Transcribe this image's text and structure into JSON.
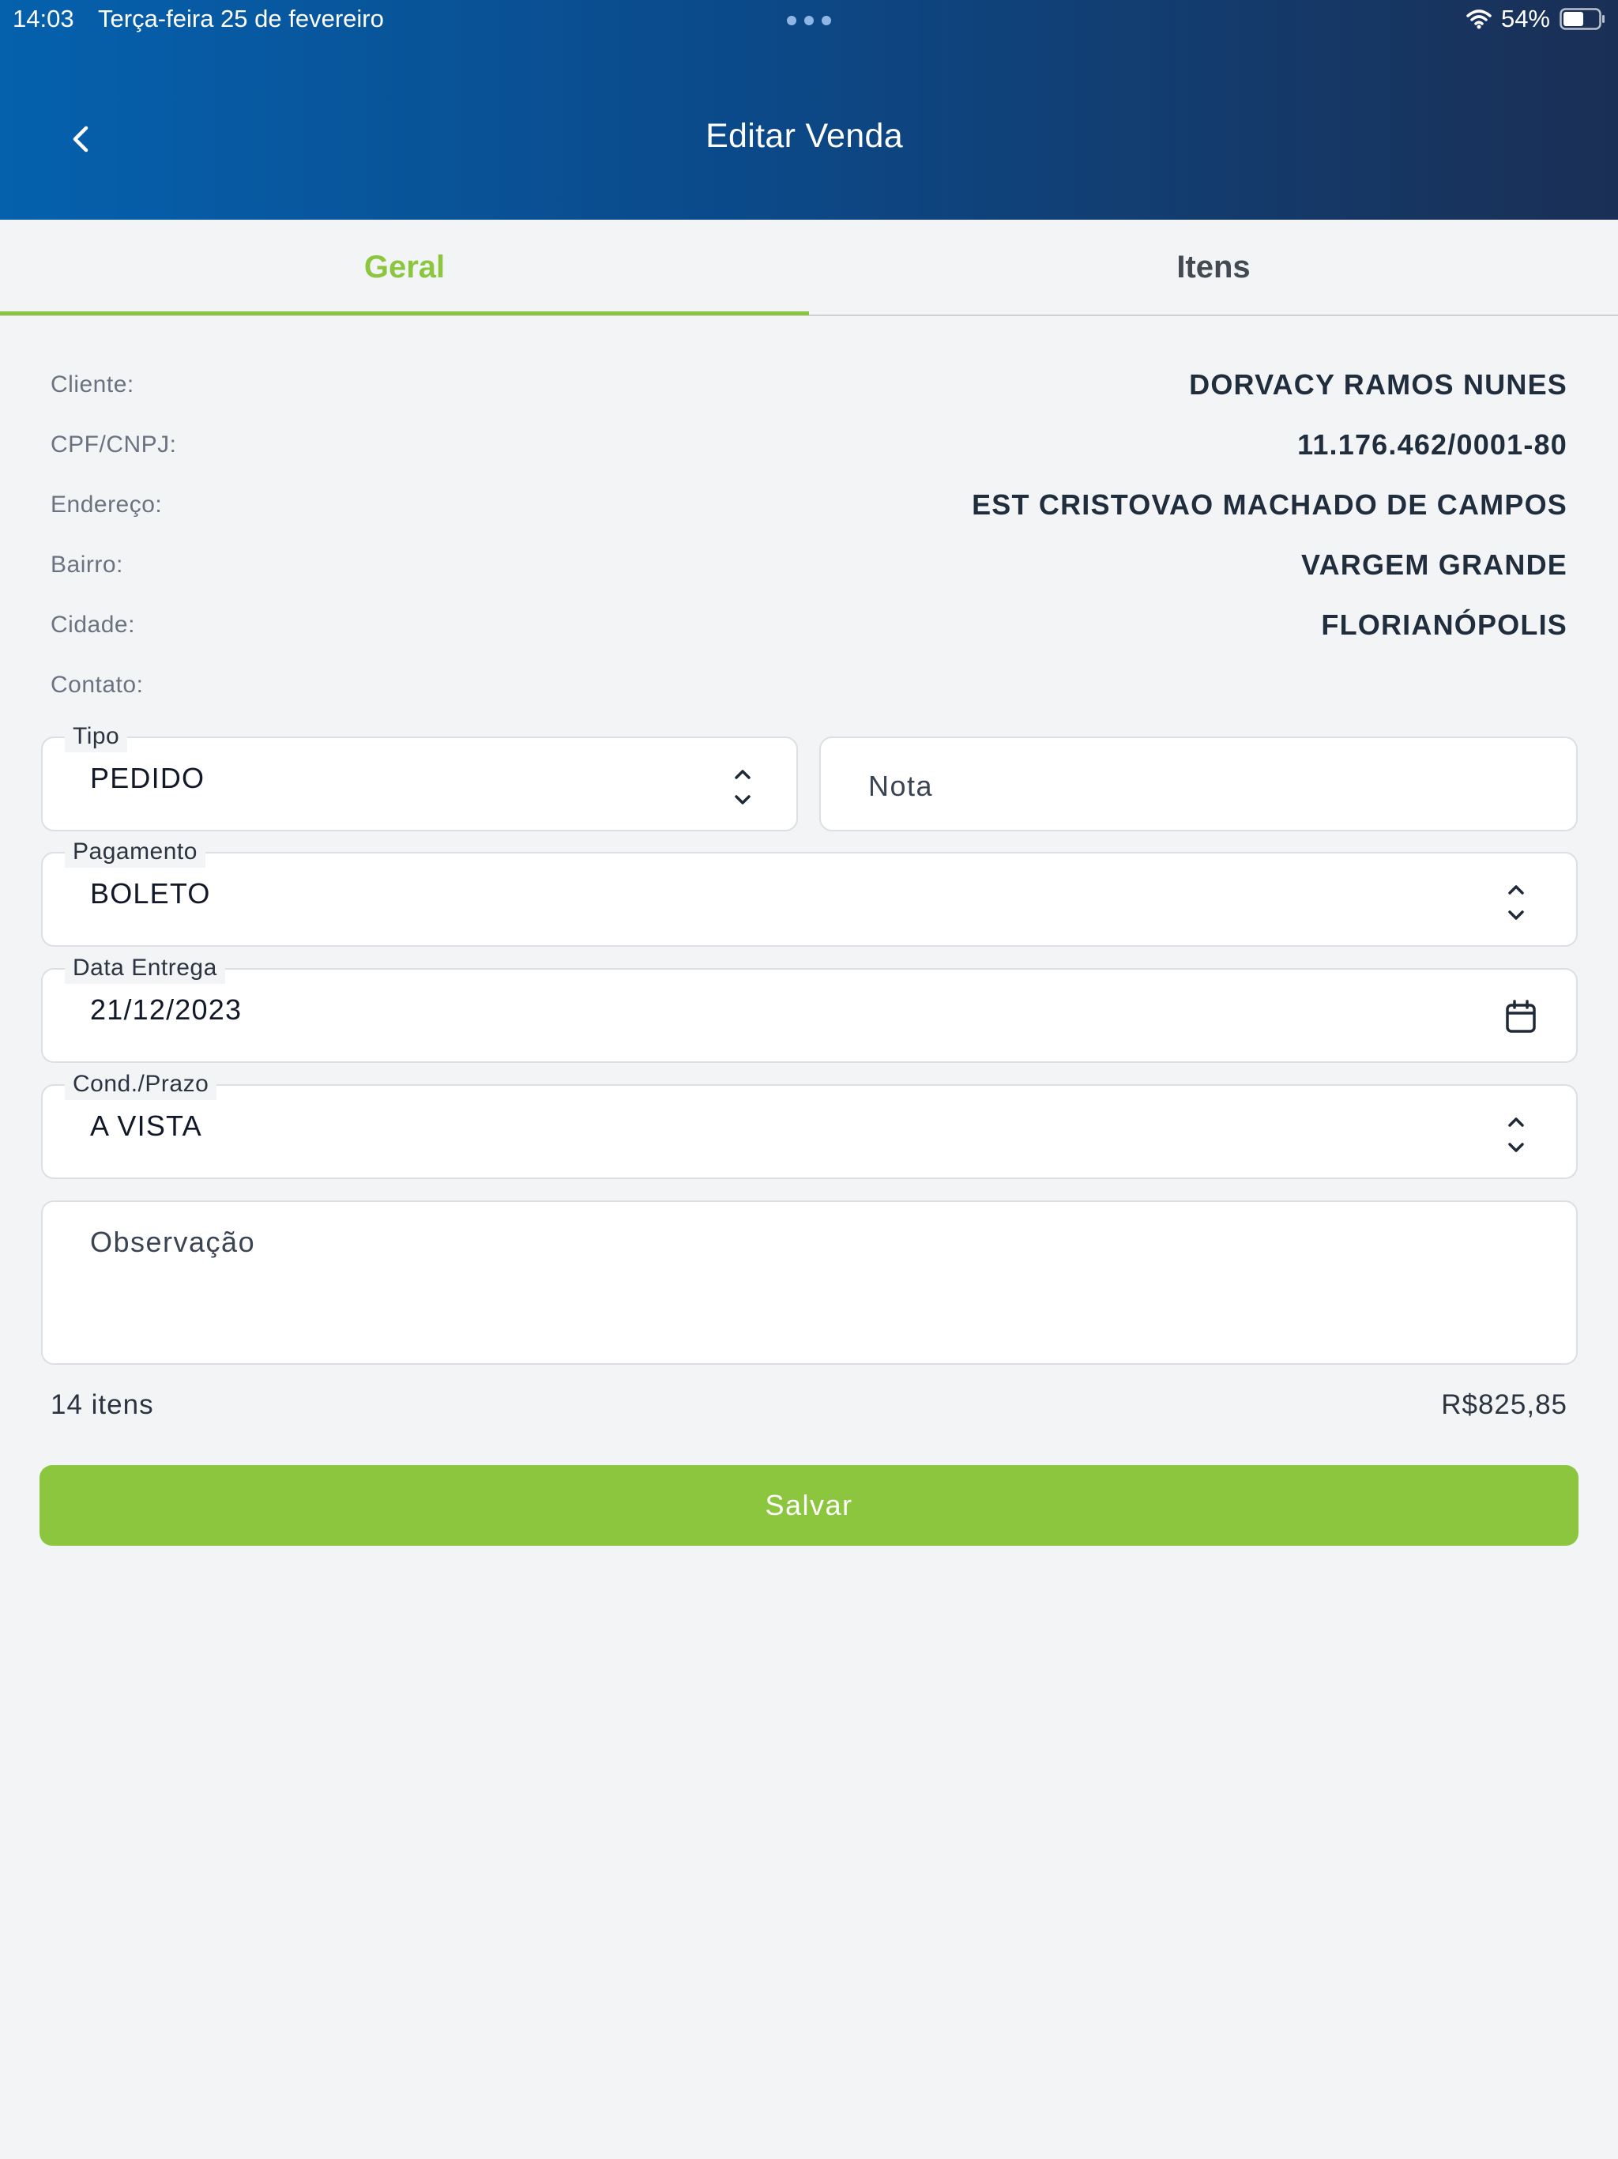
{
  "status_bar": {
    "time": "14:03",
    "date": "Terça-feira 25 de fevereiro",
    "battery": "54%"
  },
  "header": {
    "title": "Editar Venda"
  },
  "tabs": [
    {
      "label": "Geral",
      "active": true
    },
    {
      "label": "Itens",
      "active": false
    }
  ],
  "customer": {
    "client_label": "Cliente:",
    "client_value": "DORVACY RAMOS NUNES",
    "doc_label": "CPF/CNPJ:",
    "doc_value": "11.176.462/0001-80",
    "address_label": "Endereço:",
    "address_value": "EST CRISTOVAO MACHADO DE CAMPOS",
    "district_label": "Bairro:",
    "district_value": "VARGEM GRANDE",
    "city_label": "Cidade:",
    "city_value": "FLORIANÓPOLIS",
    "contact_label": "Contato:",
    "contact_value": ""
  },
  "form": {
    "tipo_label": "Tipo",
    "tipo_value": "PEDIDO",
    "nota_placeholder": "Nota",
    "pagamento_label": "Pagamento",
    "pagamento_value": "BOLETO",
    "data_entrega_label": "Data Entrega",
    "data_entrega_value": "21/12/2023",
    "cond_prazo_label": "Cond./Prazo",
    "cond_prazo_value": "A VISTA",
    "observacao_placeholder": "Observação"
  },
  "summary": {
    "items_count": "14 itens",
    "total": "R$825,85"
  },
  "actions": {
    "save_label": "Salvar"
  },
  "colors": {
    "accent": "#8cc63f",
    "header_start": "#0561ad",
    "header_end": "#1a2f55"
  },
  "icons": {
    "back": "chevron-left-icon",
    "select": "chevron-up-down-icon",
    "calendar": "calendar-icon",
    "wifi": "wifi-icon",
    "battery": "battery-icon"
  }
}
